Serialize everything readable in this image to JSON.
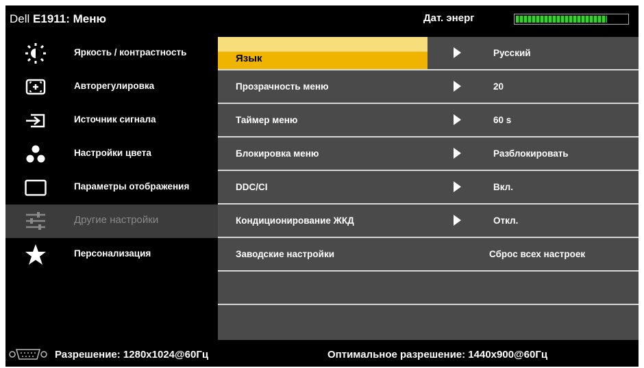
{
  "header": {
    "brand": "Dell",
    "model_menu": "E1911: Меню",
    "energy_label": "Дат. энерг",
    "energy_level_fraction": 0.82
  },
  "sidebar": {
    "items": [
      {
        "label": "Яркость / контрастность",
        "icon": "brightness-icon"
      },
      {
        "label": "Авторегулировка",
        "icon": "auto-adjust-icon"
      },
      {
        "label": "Источник сигнала",
        "icon": "input-source-icon"
      },
      {
        "label": "Настройки цвета",
        "icon": "color-settings-icon"
      },
      {
        "label": "Параметры отображения",
        "icon": "display-settings-icon"
      },
      {
        "label": "Другие настройки",
        "icon": "sliders-icon",
        "active": true
      },
      {
        "label": "Персонализация",
        "icon": "star-icon"
      }
    ]
  },
  "panel": {
    "rows": [
      {
        "label": "Язык",
        "value": "Русский",
        "arrow": true,
        "selected": true
      },
      {
        "label": "Прозрачность меню",
        "value": "20",
        "arrow": true
      },
      {
        "label": "Таймер меню",
        "value": "60 s",
        "arrow": true
      },
      {
        "label": "Блокировка меню",
        "value": "Разблокировать",
        "arrow": true
      },
      {
        "label": "DDC/CI",
        "value": "Вкл.",
        "arrow": true
      },
      {
        "label": "Кондиционирование ЖКД",
        "value": "Откл.",
        "arrow": true
      },
      {
        "label": "Заводские настройки",
        "value": "Сброс всех настроек",
        "arrow": false
      }
    ]
  },
  "status": {
    "resolution": "Разрешение: 1280x1024@60Гц",
    "optimal": "Оптимальное разрешение:  1440x900@60Гц",
    "icon": "vga-connector-icon"
  },
  "colors": {
    "selection_top": "#f7de7b",
    "selection_bottom": "#efb400",
    "panel_bg": "#4a4a4a",
    "energy_green": "#39d22c"
  }
}
